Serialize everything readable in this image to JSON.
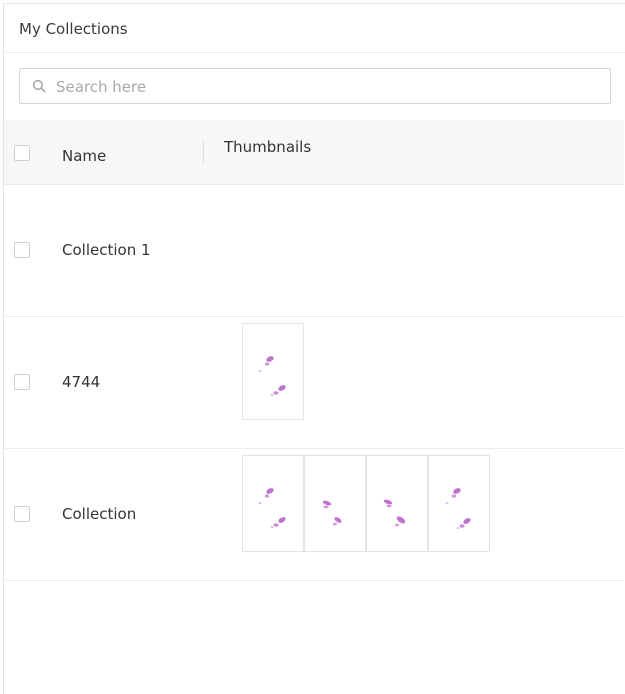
{
  "header": {
    "title": "My Collections"
  },
  "search": {
    "placeholder": "Search here",
    "value": "",
    "icon": "search-icon"
  },
  "table": {
    "columns": [
      "Name",
      "Thumbnails"
    ],
    "rows": [
      {
        "name": "Collection 1",
        "thumbnail_count": 0
      },
      {
        "name": "4744",
        "thumbnail_count": 1
      },
      {
        "name": "Collection",
        "thumbnail_count": 4
      }
    ]
  },
  "colors": {
    "stain": "#b35bc6",
    "border": "#e4e4e4",
    "header_bg": "#f7f7f7"
  }
}
